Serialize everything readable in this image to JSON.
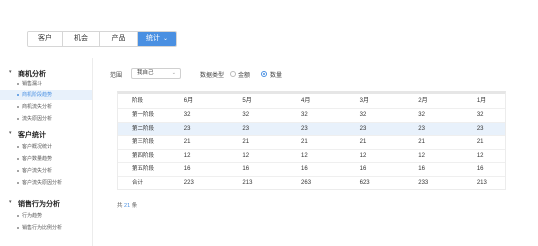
{
  "tabs": [
    {
      "label": "客户",
      "active": false
    },
    {
      "label": "机会",
      "active": false
    },
    {
      "label": "产品",
      "active": false
    },
    {
      "label": "统计",
      "active": true,
      "has_dropdown": true
    }
  ],
  "sidebar": {
    "groups": [
      {
        "title": "商机分析",
        "items": [
          {
            "label": "销售漏斗",
            "active": false
          },
          {
            "label": "商机阶段趋势",
            "active": true
          },
          {
            "label": "商机流失分析",
            "active": false
          },
          {
            "label": "流失原因分析",
            "active": false
          }
        ]
      },
      {
        "title": "客户统计",
        "items": [
          {
            "label": "客户概况统计",
            "active": false
          },
          {
            "label": "客户数量趋势",
            "active": false
          },
          {
            "label": "客户流失分析",
            "active": false
          },
          {
            "label": "客户流失原因分析",
            "active": false
          }
        ]
      },
      {
        "title": "销售行为分析",
        "items": [
          {
            "label": "行为趋势",
            "active": false
          },
          {
            "label": "销售行为比例分析",
            "active": false
          }
        ]
      }
    ]
  },
  "filters": {
    "scope_label": "范围",
    "scope_value": "我自己",
    "type_label": "数据类型",
    "options": [
      {
        "label": "金额",
        "selected": false
      },
      {
        "label": "数量",
        "selected": true
      }
    ]
  },
  "table": {
    "headers": [
      "阶段",
      "6月",
      "5月",
      "4月",
      "3月",
      "2月",
      "1月"
    ],
    "rows": [
      {
        "cells": [
          "第一阶段",
          "32",
          "32",
          "32",
          "32",
          "32",
          "32"
        ],
        "highlight": false
      },
      {
        "cells": [
          "第二阶段",
          "23",
          "23",
          "23",
          "23",
          "23",
          "23"
        ],
        "highlight": true
      },
      {
        "cells": [
          "第三阶段",
          "21",
          "21",
          "21",
          "21",
          "21",
          "21"
        ],
        "highlight": false
      },
      {
        "cells": [
          "第四阶段",
          "12",
          "12",
          "12",
          "12",
          "12",
          "12"
        ],
        "highlight": false
      },
      {
        "cells": [
          "第五阶段",
          "16",
          "16",
          "16",
          "16",
          "16",
          "16"
        ],
        "highlight": false
      },
      {
        "cells": [
          "合计",
          "223",
          "213",
          "263",
          "623",
          "233",
          "213"
        ],
        "highlight": false
      }
    ]
  },
  "footer": {
    "prefix": "共",
    "count": "21",
    "suffix": "条"
  },
  "colors": {
    "accent": "#4a90e2",
    "highlight_row": "#e8f1fb"
  }
}
